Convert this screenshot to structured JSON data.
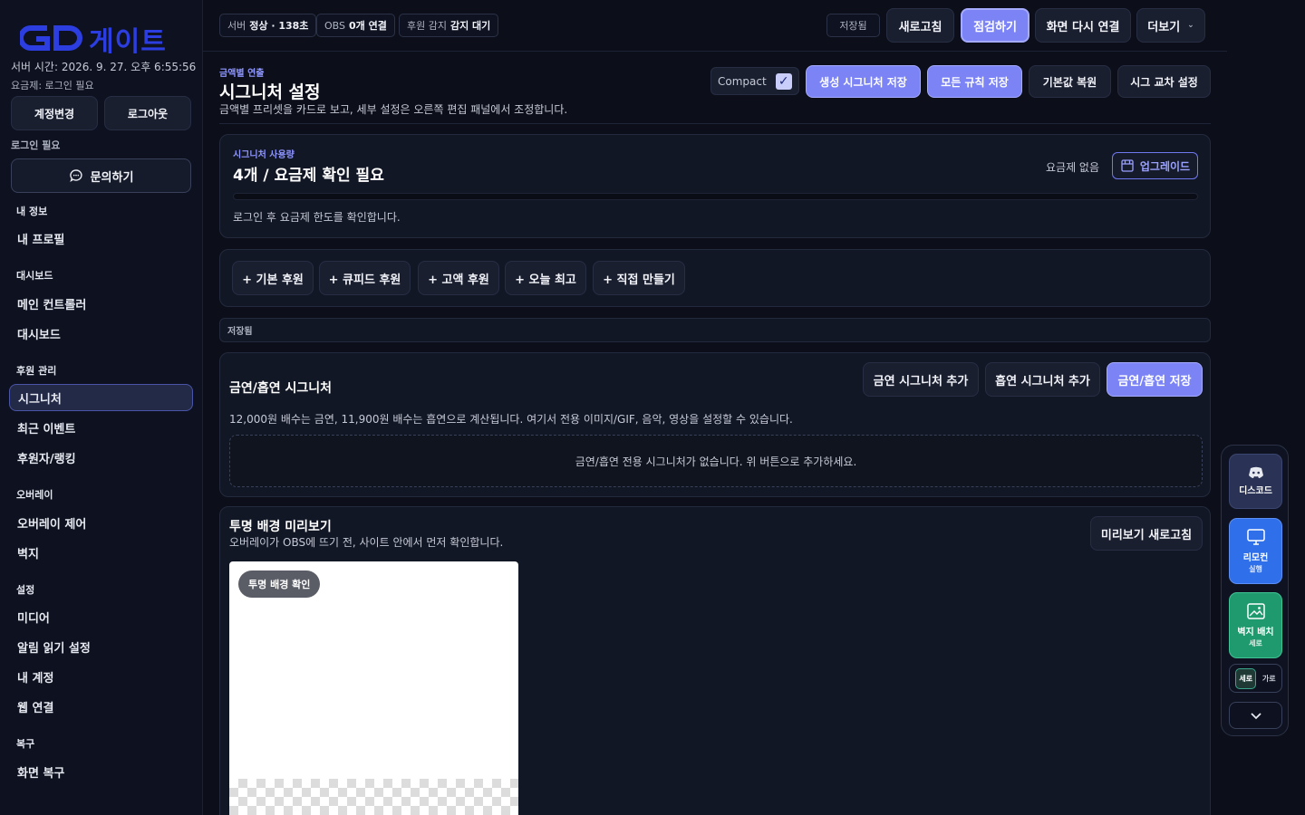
{
  "sidebar": {
    "logo_text": "게이트",
    "server_time": "서버 시간: 2026. 9. 27. 오후 6:55:56",
    "plan_line": "요금제: 로그인 필요",
    "change_account_label": "계정변경",
    "logout_label": "로그아웃",
    "login_required": "로그인 필요",
    "inquiry_label": "문의하기",
    "groups": [
      {
        "title": "내 정보",
        "items": [
          {
            "label": "내 프로필"
          }
        ]
      },
      {
        "title": "대시보드",
        "items": [
          {
            "label": "메인 컨트롤러"
          },
          {
            "label": "대시보드"
          }
        ]
      },
      {
        "title": "후원 관리",
        "items": [
          {
            "label": "시그니처"
          },
          {
            "label": "최근 이벤트"
          },
          {
            "label": "후원자/랭킹"
          }
        ]
      },
      {
        "title": "오버레이",
        "items": [
          {
            "label": "오버레이 제어"
          },
          {
            "label": "벽지"
          }
        ]
      },
      {
        "title": "설정",
        "items": [
          {
            "label": "미디어"
          },
          {
            "label": "알림 읽기 설정"
          },
          {
            "label": "내 계정"
          },
          {
            "label": "웹 연결"
          }
        ]
      },
      {
        "title": "복구",
        "items": [
          {
            "label": "화면 복구"
          }
        ]
      }
    ]
  },
  "topbar": {
    "server_status_label": "서버",
    "server_status_value": "정상 · 138초",
    "obs_label": "OBS",
    "obs_value": "0개 연결",
    "donation_label": "후원 감지",
    "donation_value": "감지 대기",
    "saved_chip": "저장됨",
    "refresh_label": "새로고침",
    "inspect_label": "점검하기",
    "reconnect_label": "화면 다시 연결",
    "more_label": "더보기"
  },
  "header": {
    "eyebrow": "금액별 연출",
    "title": "시그니처 설정",
    "description": "금액별 프리셋을 카드로 보고, 세부 설정은 오른쪽 편집 패널에서 조정합니다.",
    "compact_label": "Compact",
    "compact_checked": true,
    "save_generated_label": "생성 시그니처 저장",
    "save_all_rules_label": "모든 규칙 저장",
    "restore_defaults_label": "기본값 복원",
    "cross_setting_label": "시그 교차 설정"
  },
  "usage": {
    "eyebrow": "시그니처 사용량",
    "title": "4개 / 요금제 확인 필요",
    "no_plan": "요금제 없음",
    "upgrade_label": "업그레이드",
    "progress_percent": 0,
    "note": "로그인 후 요금제 한도를 확인합니다."
  },
  "presets": [
    {
      "label": "+ 기본 후원"
    },
    {
      "label": "+ 큐피드 후원"
    },
    {
      "label": "+ 고액 후원"
    },
    {
      "label": "+ 오늘 최고"
    },
    {
      "label": "+ 직접 만들기"
    }
  ],
  "saved_status": "저장됨",
  "ban_section": {
    "title": "금연/흡연 시그니처",
    "add_ban_label": "금연 시그니처 추가",
    "add_smoke_label": "흡연 시그니처 추가",
    "save_label": "금연/흡연 저장",
    "description": "12,000원 배수는 금연, 11,900원 배수는 흡연으로 계산됩니다. 여기서 전용 이미지/GIF, 음악, 영상을 설정할 수 있습니다.",
    "empty_message": "금연/흡연 전용 시그니처가 없습니다. 위 버튼으로 추가하세요."
  },
  "preview_section": {
    "title": "투명 배경 미리보기",
    "description": "오버레이가 OBS에 뜨기 전, 사이트 안에서 먼저 확인합니다.",
    "refresh_label": "미리보기 새로고침",
    "check_pill": "투명 배경 확인"
  },
  "dock": {
    "discord_label": "디스코드",
    "remote_label": "리모컨",
    "remote_sub": "실행",
    "wallpaper_label": "벽지 배치",
    "wallpaper_sub": "세로",
    "toggle_vertical": "세로",
    "toggle_horizontal": "가로"
  },
  "colors": {
    "accent": "#7b83f5",
    "remote_tile": "#2f6fea",
    "wallpaper_tile": "#1f9a6e",
    "discord_tile": "#2a3355"
  }
}
